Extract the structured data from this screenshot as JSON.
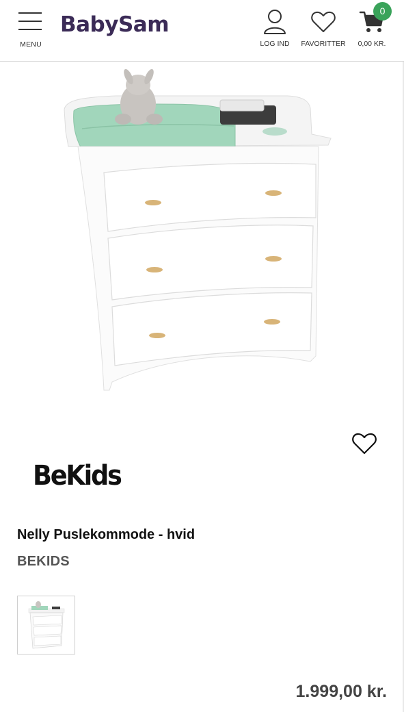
{
  "header": {
    "menu_label": "MENU",
    "logo_text": "BabySam",
    "login_label": "LOG IND",
    "favorites_label": "FAVORITTER",
    "cart_total": "0,00 KR.",
    "cart_count": "0"
  },
  "product": {
    "brand_logo_text": "BeKids",
    "title": "Nelly Puslekommode - hvid",
    "brand": "BEKIDS",
    "price": "1.999,00 kr."
  },
  "colors": {
    "logo": "#3b2b57",
    "cart_badge": "#3aa35a",
    "changing_pad": "#9fd4b8",
    "text": "#1a1a1a"
  }
}
